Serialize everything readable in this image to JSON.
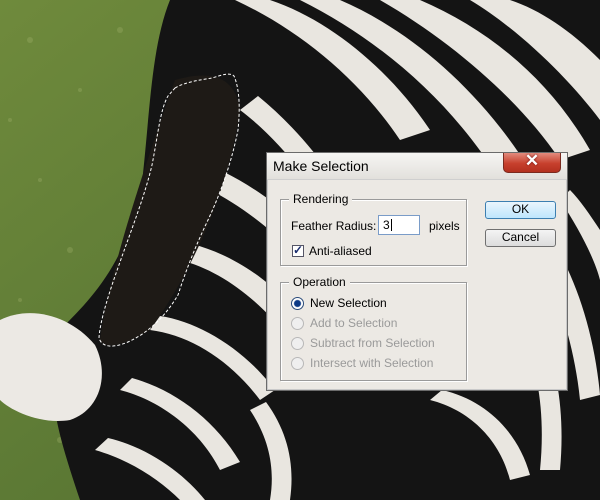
{
  "dialog": {
    "title": "Make Selection",
    "close_glyph": "✕",
    "ok_label": "OK",
    "cancel_label": "Cancel"
  },
  "rendering": {
    "legend": "Rendering",
    "feather_label": "Feather Radius:",
    "feather_value": "3",
    "unit": "pixels",
    "antialias_label": "Anti-aliased",
    "antialias_checked": true
  },
  "operation": {
    "legend": "Operation",
    "options": [
      {
        "label": "New Selection",
        "selected": true,
        "enabled": true
      },
      {
        "label": "Add to Selection",
        "selected": false,
        "enabled": false
      },
      {
        "label": "Subtract from Selection",
        "selected": false,
        "enabled": false
      },
      {
        "label": "Intersect with Selection",
        "selected": false,
        "enabled": false
      }
    ]
  },
  "icons": {
    "close": "close-icon",
    "checkbox_mark": "check-icon"
  },
  "colors": {
    "close_button": "#c7402d",
    "default_button_border": "#3c7fb1",
    "selection_marquee": "#ffffff"
  }
}
